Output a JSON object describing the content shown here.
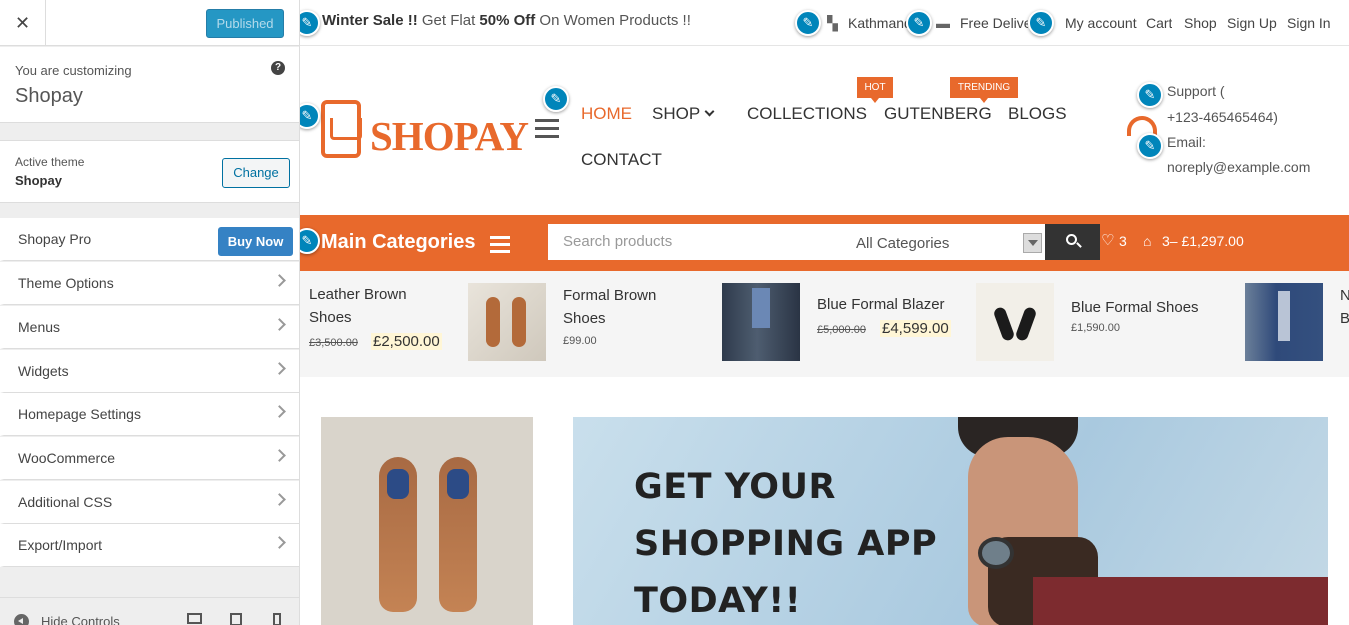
{
  "sidebar": {
    "close": "✕",
    "publish": "Published",
    "customizing_label": "You are customizing",
    "site_name": "Shopay",
    "help": "?",
    "active_theme_label": "Active theme",
    "active_theme": "Shopay",
    "change": "Change",
    "pro_label": "Shopay Pro",
    "buy_now": "Buy Now",
    "items": [
      "Theme Options",
      "Menus",
      "Widgets",
      "Homepage Settings",
      "WooCommerce",
      "Additional CSS",
      "Export/Import"
    ],
    "hide_controls": "Hide Controls"
  },
  "topbar": {
    "promo_bold1": "Winter Sale !!",
    "promo_mid": " Get Flat ",
    "promo_bold2": "50% Off",
    "promo_end": " On Women Products !!",
    "location": "Kathmandu",
    "delivery": "Free Delivery",
    "links": [
      "My account",
      "Cart",
      "Shop",
      "Sign Up",
      "Sign In"
    ]
  },
  "header": {
    "logo": "SHOPAY",
    "nav": [
      "HOME",
      "SHOP",
      "COLLECTIONS",
      "GUTENBERG",
      "BLOGS",
      "CONTACT"
    ],
    "badge_hot": "HOT",
    "badge_trending": "TRENDING",
    "support_line1": "Support (",
    "support_line2": "+123-465465464)",
    "email_line1": "Email:",
    "email_line2": "noreply@example.com"
  },
  "catbar": {
    "title": "Main Categories",
    "search_placeholder": "Search products",
    "category_select": "All Categories",
    "wishlist_count": "3",
    "cart_summary": "3– £1,297.00"
  },
  "products": [
    {
      "name1": "Leather Brown",
      "name2": "Shoes",
      "old": "£3,500.00",
      "price": "£2,500.00"
    },
    {
      "name1": "Formal Brown",
      "name2": "Shoes",
      "price": "£99.00"
    },
    {
      "name1": "Blue Formal Blazer",
      "old": "£5,000.00",
      "price": "£4,599.00"
    },
    {
      "name1": "Blue Formal Shoes",
      "price": "£1,590.00"
    },
    {
      "name1": "N",
      "name2": "B"
    }
  ],
  "banner": {
    "line1": "GET YOUR",
    "line2": "SHOPPING APP",
    "line3": "TODAY!!"
  },
  "colors": {
    "accent": "#e8692c",
    "wp_blue": "#0085ba"
  }
}
